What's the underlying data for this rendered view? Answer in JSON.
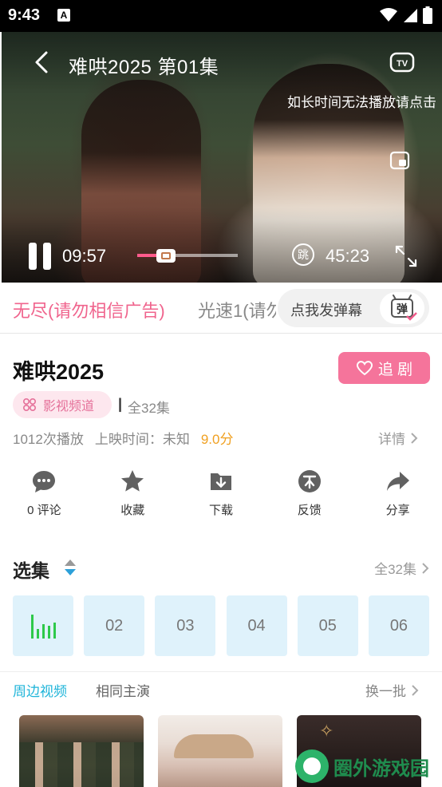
{
  "status_bar": {
    "time": "9:43",
    "notification_icon": "A"
  },
  "player": {
    "title": "难哄2025  第01集",
    "notice": "如长时间无法播放请点击",
    "current_time": "09:57",
    "total_time": "45:23",
    "skip_label": "跳",
    "progress": 0.22
  },
  "sources": {
    "tab1": "无尽(请勿相信广告)",
    "tab2": "光速1(请勿",
    "danmaku_label": "点我发弹幕",
    "danmaku_icon_label": "弹"
  },
  "show": {
    "title": "难哄2025",
    "follow_label": "追 剧",
    "channel_tag": "影视频道",
    "separator": "|",
    "episode_count": "全32集",
    "plays": "1012次播放",
    "release": "上映时间：未知",
    "score": "9.0分",
    "details": "详情"
  },
  "actions": [
    {
      "label": "0 评论",
      "icon": "comment-icon"
    },
    {
      "label": "收藏",
      "icon": "star-icon"
    },
    {
      "label": "下载",
      "icon": "download-icon"
    },
    {
      "label": "反馈",
      "icon": "feedback-icon"
    },
    {
      "label": "分享",
      "icon": "share-icon"
    }
  ],
  "episodes": {
    "title": "选集",
    "all_label": "全32集",
    "items": [
      "",
      "02",
      "03",
      "04",
      "05",
      "06"
    ]
  },
  "related": {
    "tab_nearby": "周边视频",
    "tab_same_cast": "相同主演",
    "refresh": "换一批"
  },
  "watermark": {
    "text": "圈外游戏园"
  },
  "colors": {
    "accent_pink": "#f5749b",
    "accent_blue": "#1eb4d9",
    "playing_green": "#2ec94a"
  }
}
